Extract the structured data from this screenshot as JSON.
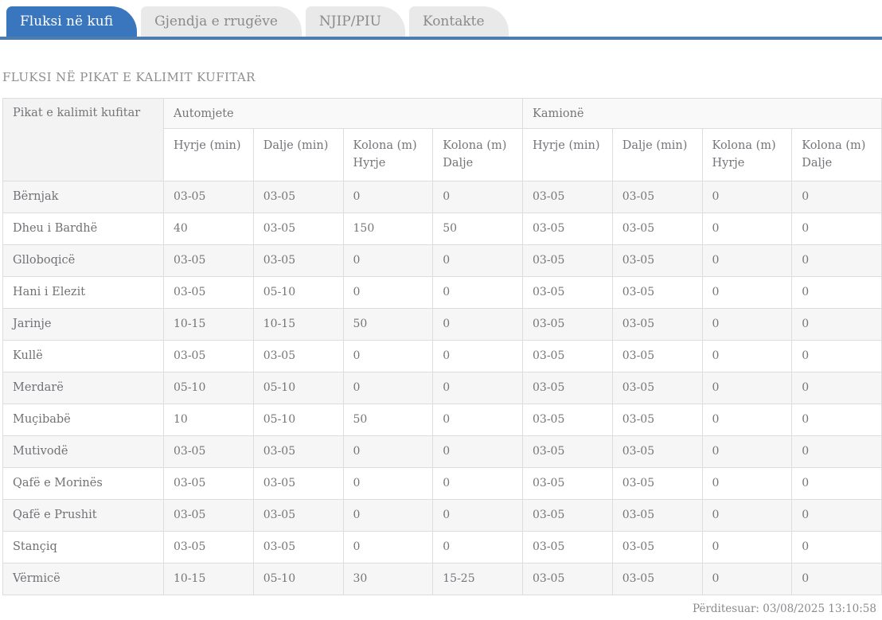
{
  "tabs": [
    {
      "label": "Fluksi në kufi",
      "active": true
    },
    {
      "label": "Gjendja e rrugëve",
      "active": false
    },
    {
      "label": "NJIP/PIU",
      "active": false
    },
    {
      "label": "Kontakte",
      "active": false
    }
  ],
  "page_title": "FLUKSI NË PIKAT E KALIMIT KUFITAR",
  "table": {
    "name_column_header": "Pikat e kalimit kufitar",
    "groups": [
      {
        "label": "Automjete",
        "columns": [
          "Hyrje (min)",
          "Dalje (min)",
          "Kolona (m) Hyrje",
          "Kolona (m) Dalje"
        ]
      },
      {
        "label": "Kamionë",
        "columns": [
          "Hyrje (min)",
          "Dalje (min)",
          "Kolona (m) Hyrje",
          "Kolona (m) Dalje"
        ]
      }
    ],
    "rows": [
      {
        "name": "Bërnjak",
        "values": [
          "03-05",
          "03-05",
          "0",
          "0",
          "03-05",
          "03-05",
          "0",
          "0"
        ]
      },
      {
        "name": "Dheu i Bardhë",
        "values": [
          "40",
          "03-05",
          "150",
          "50",
          "03-05",
          "03-05",
          "0",
          "0"
        ]
      },
      {
        "name": "Glloboqicë",
        "values": [
          "03-05",
          "03-05",
          "0",
          "0",
          "03-05",
          "03-05",
          "0",
          "0"
        ]
      },
      {
        "name": "Hani i Elezit",
        "values": [
          "03-05",
          "05-10",
          "0",
          "0",
          "03-05",
          "03-05",
          "0",
          "0"
        ]
      },
      {
        "name": "Jarinje",
        "values": [
          "10-15",
          "10-15",
          "50",
          "0",
          "03-05",
          "03-05",
          "0",
          "0"
        ]
      },
      {
        "name": "Kullë",
        "values": [
          "03-05",
          "03-05",
          "0",
          "0",
          "03-05",
          "03-05",
          "0",
          "0"
        ]
      },
      {
        "name": "Merdarë",
        "values": [
          "05-10",
          "05-10",
          "0",
          "0",
          "03-05",
          "03-05",
          "0",
          "0"
        ]
      },
      {
        "name": "Muçibabë",
        "values": [
          "10",
          "05-10",
          "50",
          "0",
          "03-05",
          "03-05",
          "0",
          "0"
        ]
      },
      {
        "name": "Mutivodë",
        "values": [
          "03-05",
          "03-05",
          "0",
          "0",
          "03-05",
          "03-05",
          "0",
          "0"
        ]
      },
      {
        "name": "Qafë e Morinës",
        "values": [
          "03-05",
          "03-05",
          "0",
          "0",
          "03-05",
          "03-05",
          "0",
          "0"
        ]
      },
      {
        "name": "Qafë e Prushit",
        "values": [
          "03-05",
          "03-05",
          "0",
          "0",
          "03-05",
          "03-05",
          "0",
          "0"
        ]
      },
      {
        "name": "Stançiq",
        "values": [
          "03-05",
          "03-05",
          "0",
          "0",
          "03-05",
          "03-05",
          "0",
          "0"
        ]
      },
      {
        "name": "Vërmicë",
        "values": [
          "10-15",
          "05-10",
          "30",
          "15-25",
          "03-05",
          "03-05",
          "0",
          "0"
        ]
      }
    ]
  },
  "footer": {
    "updated_label": "Përditesuar: 03/08/2025 13:10:58"
  },
  "colors": {
    "active_tab_blue": "#3a76bd",
    "tab_bar_blue": "#4d7dae",
    "inactive_tab_gray": "#e9e9e9",
    "zebra_row_gray": "#f6f6f6",
    "border_gray": "#dddddd",
    "text_gray": "#75757a"
  }
}
